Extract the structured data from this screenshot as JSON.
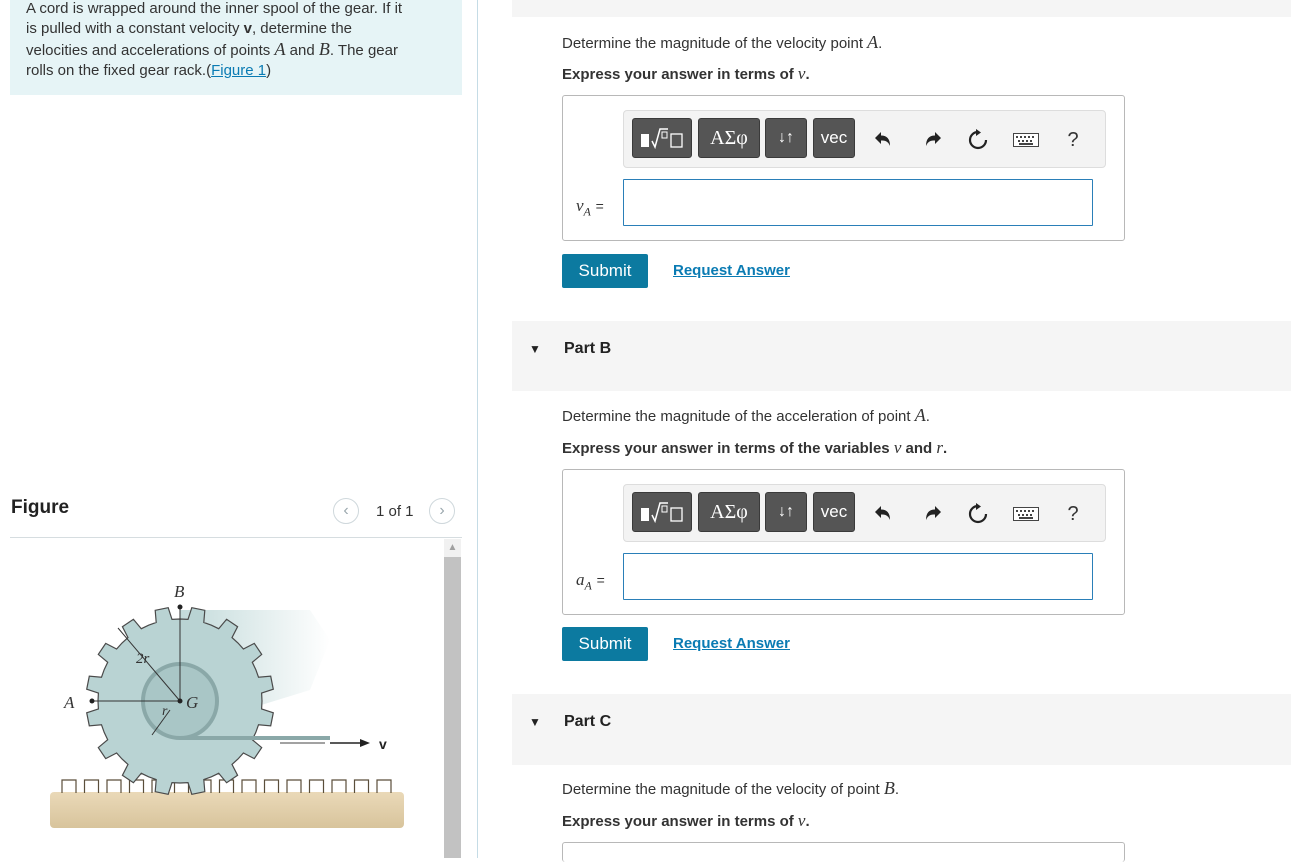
{
  "problem": {
    "lines": [
      "A cord is wrapped around the inner spool of the gear. If it",
      "is pulled with a constant velocity ",
      "velocities and accelerations of points ",
      "rolls on the fixed gear rack."
    ],
    "bold_v": "v",
    "line2_tail": ", determine the",
    "point_A": "A",
    "and": " and ",
    "point_B": "B",
    "line3_tail": ". The gear",
    "figure_link": "Figure 1",
    "paren_open": "(",
    "paren_close": ")"
  },
  "figure_panel": {
    "title": "Figure",
    "count": "1 of 1",
    "prev_icon": "chevron-left-icon",
    "next_icon": "chevron-right-icon",
    "labels": {
      "B": "B",
      "A": "A",
      "G": "G",
      "two_r": "2r",
      "r": "r",
      "v": "v"
    }
  },
  "top_bar_visible": true,
  "parts": [
    {
      "id": "A",
      "question_prefix": "Determine the magnitude of the velocity point ",
      "question_var": "A",
      "question_suffix": ".",
      "instr_prefix": "Express your answer in terms of ",
      "instr_var": "v",
      "instr_suffix": ".",
      "answer_var": "v",
      "answer_sub": "A",
      "equals": "=",
      "submit": "Submit",
      "request": "Request Answer"
    },
    {
      "id": "B",
      "label": "Part B",
      "question_prefix": "Determine the magnitude of the acceleration of point ",
      "question_var": "A",
      "question_suffix": ".",
      "instr_prefix": "Express your answer in terms of the variables ",
      "instr_var": "v",
      "instr_mid": " and ",
      "instr_var2": "r",
      "instr_suffix": ".",
      "answer_var": "a",
      "answer_sub": "A",
      "equals": "=",
      "submit": "Submit",
      "request": "Request Answer"
    },
    {
      "id": "C",
      "label": "Part C",
      "question_prefix": "Determine the magnitude of the velocity of point ",
      "question_var": "B",
      "question_suffix": ".",
      "instr_prefix": "Express your answer in terms of ",
      "instr_var": "v",
      "instr_suffix": "."
    }
  ],
  "toolbar": {
    "greek": "ΑΣφ",
    "arrows": "↓↑",
    "vec": "vec",
    "help": "?",
    "icons": [
      "templates-icon",
      "undo-icon",
      "redo-icon",
      "reset-icon",
      "keyboard-icon"
    ]
  },
  "colors": {
    "accent": "#0c7aa0",
    "link": "#0a7bb3",
    "problem_bg": "#e6f4f6",
    "gear": "#b9d3d3"
  }
}
